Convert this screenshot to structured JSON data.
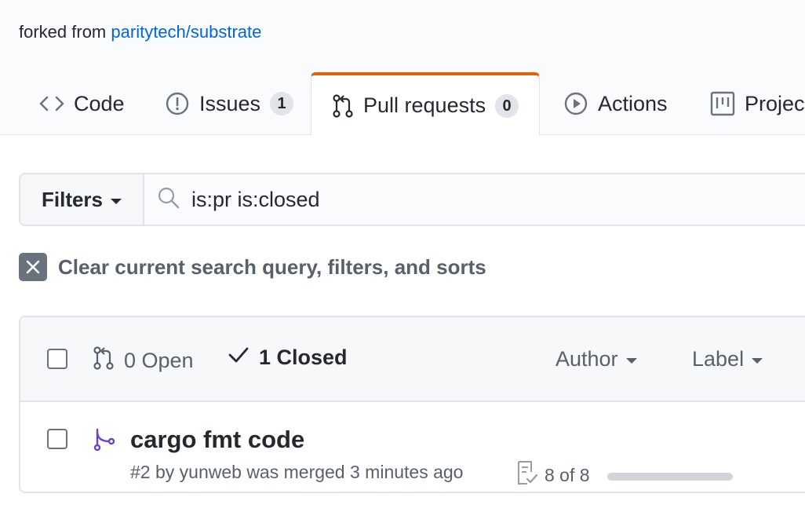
{
  "repo": {
    "forked_prefix": "forked from",
    "forked_link": "paritytech/substrate"
  },
  "tabs": [
    {
      "label": "Code",
      "icon": "code-icon"
    },
    {
      "label": "Issues",
      "icon": "issue-opened-icon",
      "count": "1"
    },
    {
      "label": "Pull requests",
      "icon": "git-pull-request-icon",
      "count": "0",
      "selected": true
    },
    {
      "label": "Actions",
      "icon": "play-icon"
    },
    {
      "label": "Projec",
      "icon": "project-icon"
    }
  ],
  "filters": {
    "button_label": "Filters",
    "search_value": "is:pr is:closed"
  },
  "clear_query": {
    "label": "Clear current search query, filters, and sorts"
  },
  "list_header": {
    "open_label": "0 Open",
    "closed_label": "1 Closed",
    "author_label": "Author",
    "label_label": "Label"
  },
  "pull_requests": [
    {
      "title": "cargo fmt code",
      "meta": "#2 by yunweb was merged 3 minutes ago",
      "checks_label": "8 of 8",
      "checks_progress": 1.0
    }
  ],
  "colors": {
    "accent_tab": "#e36209",
    "link": "#0366d6",
    "merged": "#6f42c1"
  }
}
